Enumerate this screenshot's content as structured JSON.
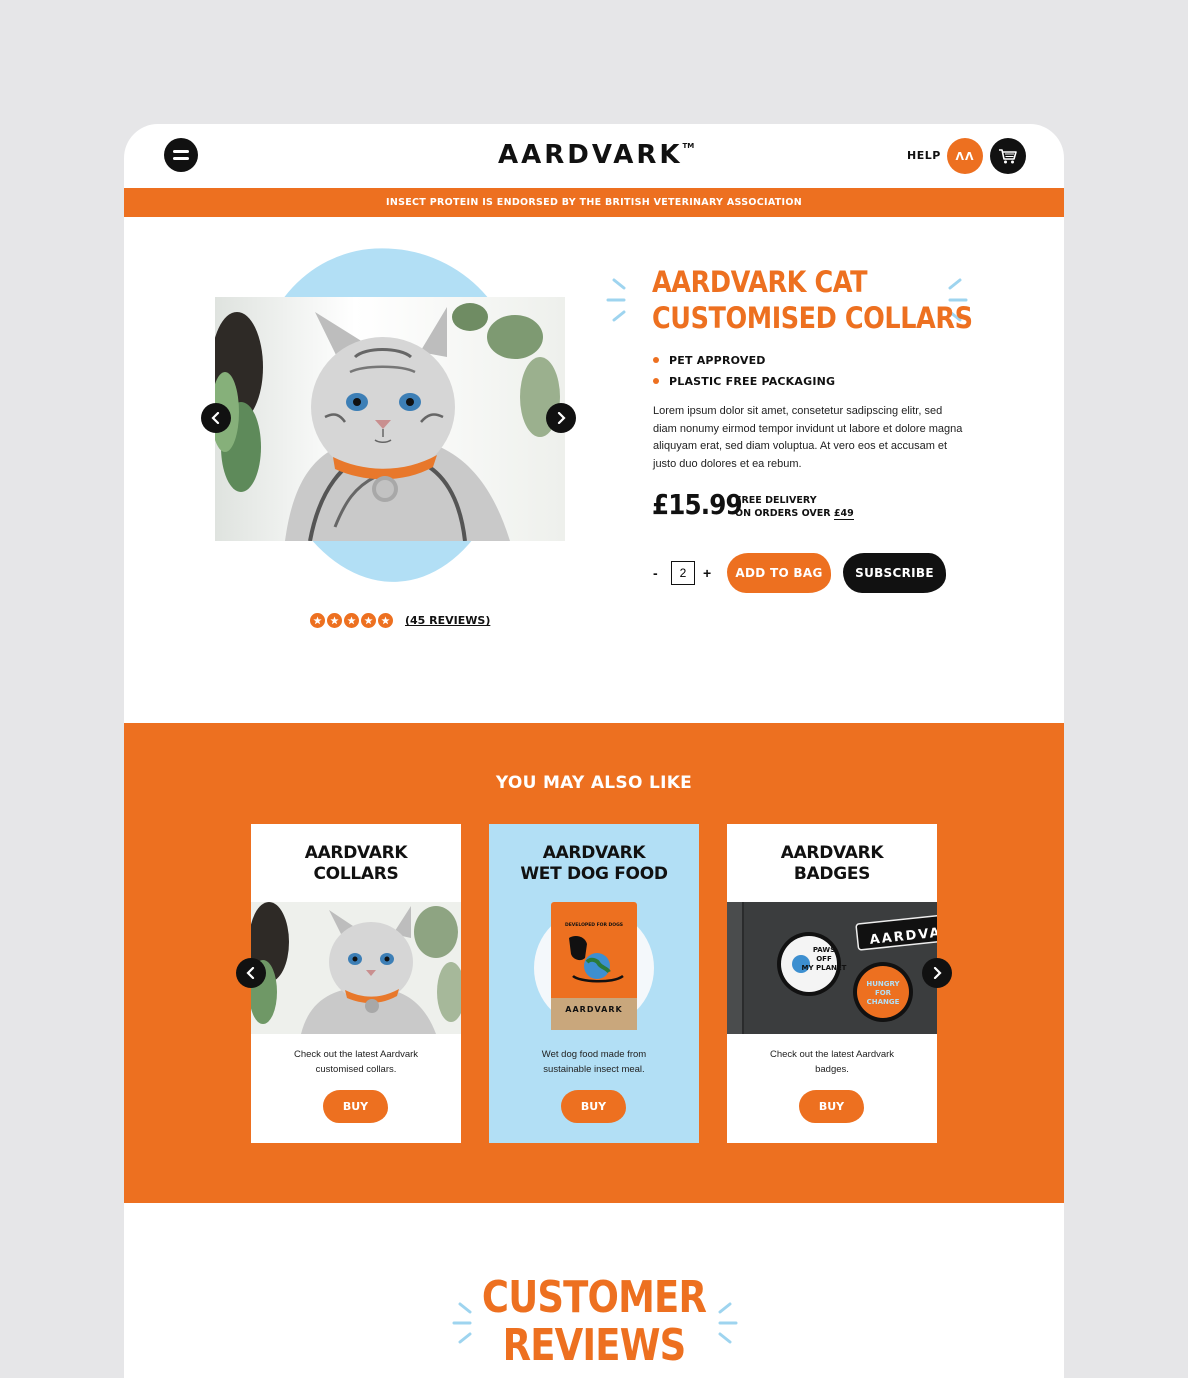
{
  "header": {
    "logo": "AARDVARK",
    "logo_tm": "TM",
    "help_label": "HELP",
    "account_initials": "ΛΛ",
    "icons": {
      "menu": "hamburger-menu-icon",
      "cart": "cart-icon"
    }
  },
  "banner": {
    "text": "INSECT PROTEIN IS ENDORSED BY THE BRITISH VETERINARY ASSOCIATION"
  },
  "product": {
    "title_line1": "AARDVARK CAT",
    "title_line2": "CUSTOMISED COLLARS",
    "features": [
      "PET APPROVED",
      "PLASTIC FREE PACKAGING"
    ],
    "description": "Lorem ipsum dolor sit amet, consetetur sadipscing elitr, sed diam nonumy eirmod tempor invidunt ut labore et dolore magna aliquyam erat, sed diam voluptua. At vero eos et accusam et justo duo dolores et ea rebum.",
    "price": "£15.99",
    "delivery_line1": "FREE DELIVERY",
    "delivery_line2_prefix": "ON ORDERS OVER ",
    "delivery_amount": "£49",
    "quantity": "2",
    "qty_minus": "-",
    "qty_plus": "+",
    "add_to_bag_label": "ADD TO BAG",
    "subscribe_label": "SUBSCRIBE",
    "rating": 5,
    "reviews_label": "(45 REVIEWS)"
  },
  "related": {
    "heading": "YOU MAY ALSO LIKE",
    "cards": [
      {
        "title_line1": "AARDVARK",
        "title_line2": "COLLARS",
        "desc_line1": "Check out the latest Aardvark",
        "desc_line2": "customised collars.",
        "buy_label": "BUY"
      },
      {
        "title_line1": "AARDVARK",
        "title_line2": "WET DOG FOOD",
        "desc_line1": "Wet dog food made from",
        "desc_line2": "sustainable insect meal.",
        "buy_label": "BUY",
        "pack_top": "DEVELOPED FOR DOGS",
        "pack_brand": "AARDVARK"
      },
      {
        "title_line1": "AARDVARK",
        "title_line2": "BADGES",
        "desc_line1": "Check out the latest Aardvark",
        "desc_line2": "badges.",
        "buy_label": "BUY",
        "badge1": "PAWS OFF MY PLANET",
        "badge2": "HUNGRY FOR CHANGE",
        "patch": "AARDVA"
      }
    ]
  },
  "reviews": {
    "title_line1": "CUSTOMER",
    "title_line2": "REVIEWS"
  },
  "colors": {
    "brand_orange": "#ed7020",
    "light_blue": "#b2dff5",
    "black": "#111111",
    "page_bg": "#e6e6e8"
  }
}
